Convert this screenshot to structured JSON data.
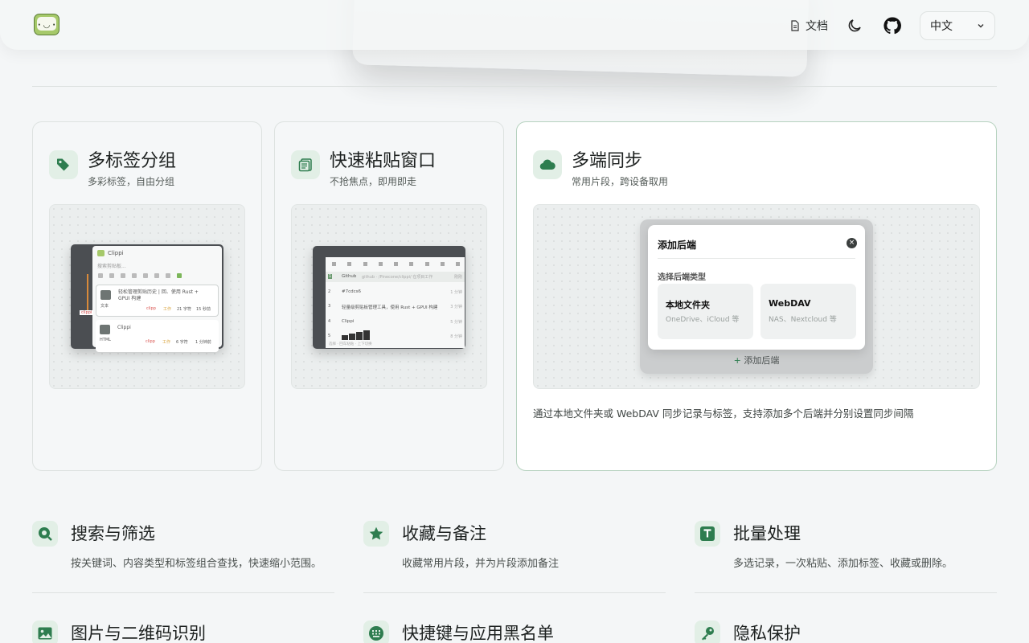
{
  "header": {
    "docs_label": "文档",
    "language": "中文",
    "logo_icon": "clipboard-face-logo",
    "theme_icon": "moon-icon",
    "github_icon": "github-icon"
  },
  "cards": [
    {
      "title": "多标签分组",
      "subtitle": "多彩标签，自由分组",
      "icon": "tag-icon",
      "mock": {
        "app_name": "Clippi",
        "search_placeholder": "搜索剪贴板...",
        "item1_text": "轻松管理剪贴历史 | 回、使用 Rust + GPUI 构建",
        "item1_type": "文本",
        "item1_tags": [
          "clipp",
          "工作"
        ],
        "item1_meta": [
          "21 字符",
          "15 秒前"
        ],
        "item2_text": "Clippi",
        "item2_type": "HTML",
        "item2_tags": [
          "clipp",
          "工作"
        ],
        "item2_meta": [
          "6 字符",
          "1 分钟前"
        ],
        "side_tag": "clippi"
      }
    },
    {
      "title": "快速粘贴窗口",
      "subtitle": "不抢焦点，即用即走",
      "icon": "clipboard-list-icon",
      "mock": {
        "rows": [
          {
            "num": "1",
            "text": "Github",
            "hint": "github · /Pinecone/clippi/ 在项目工作",
            "time": "刚刚"
          },
          {
            "num": "2",
            "text": "#7cdcs6",
            "hint": "",
            "time": "1 分钟"
          },
          {
            "num": "3",
            "text": "轻量级剪贴板管理工具，使用 Rust + GPUI 构建",
            "hint": "",
            "time": "3 分钟"
          },
          {
            "num": "4",
            "text": "Clippi",
            "hint": "",
            "time": "5 分钟"
          },
          {
            "num": "5",
            "text": "",
            "hint": "",
            "time": "8 分钟"
          }
        ],
        "footer": "选择 · 回车粘贴 · 上下切换"
      }
    },
    {
      "title": "多端同步",
      "subtitle": "常用片段，跨设备取用",
      "icon": "cloud-icon",
      "description": "通过本地文件夹或 WebDAV 同步记录与标签，支持添加多个后端并分别设置同步间隔",
      "dialog": {
        "title": "添加后端",
        "section_label": "选择后端类型",
        "options": [
          {
            "name": "本地文件夹",
            "hint": "OneDrive、iCloud 等"
          },
          {
            "name": "WebDAV",
            "hint": "NAS、Nextcloud 等"
          }
        ],
        "add_label": "添加后端"
      }
    }
  ],
  "features": [
    {
      "title": "搜索与筛选",
      "desc": "按关键词、内容类型和标签组合查找，快速缩小范围。",
      "icon": "search-icon"
    },
    {
      "title": "收藏与备注",
      "desc": "收藏常用片段，并为片段添加备注",
      "icon": "star-icon"
    },
    {
      "title": "批量处理",
      "desc": "多选记录，一次粘贴、添加标签、收藏或删除。",
      "icon": "text-t-icon"
    },
    {
      "title": "图片与二维码识别",
      "desc": "",
      "icon": "image-icon"
    },
    {
      "title": "快捷键与应用黑名单",
      "desc": "",
      "icon": "keyboard-icon"
    },
    {
      "title": "隐私保护",
      "desc": "",
      "icon": "key-icon"
    }
  ],
  "colors": {
    "accent": "#2e7d4f",
    "icon_bg": "#e2efe6",
    "background": "#f4f6f7"
  }
}
